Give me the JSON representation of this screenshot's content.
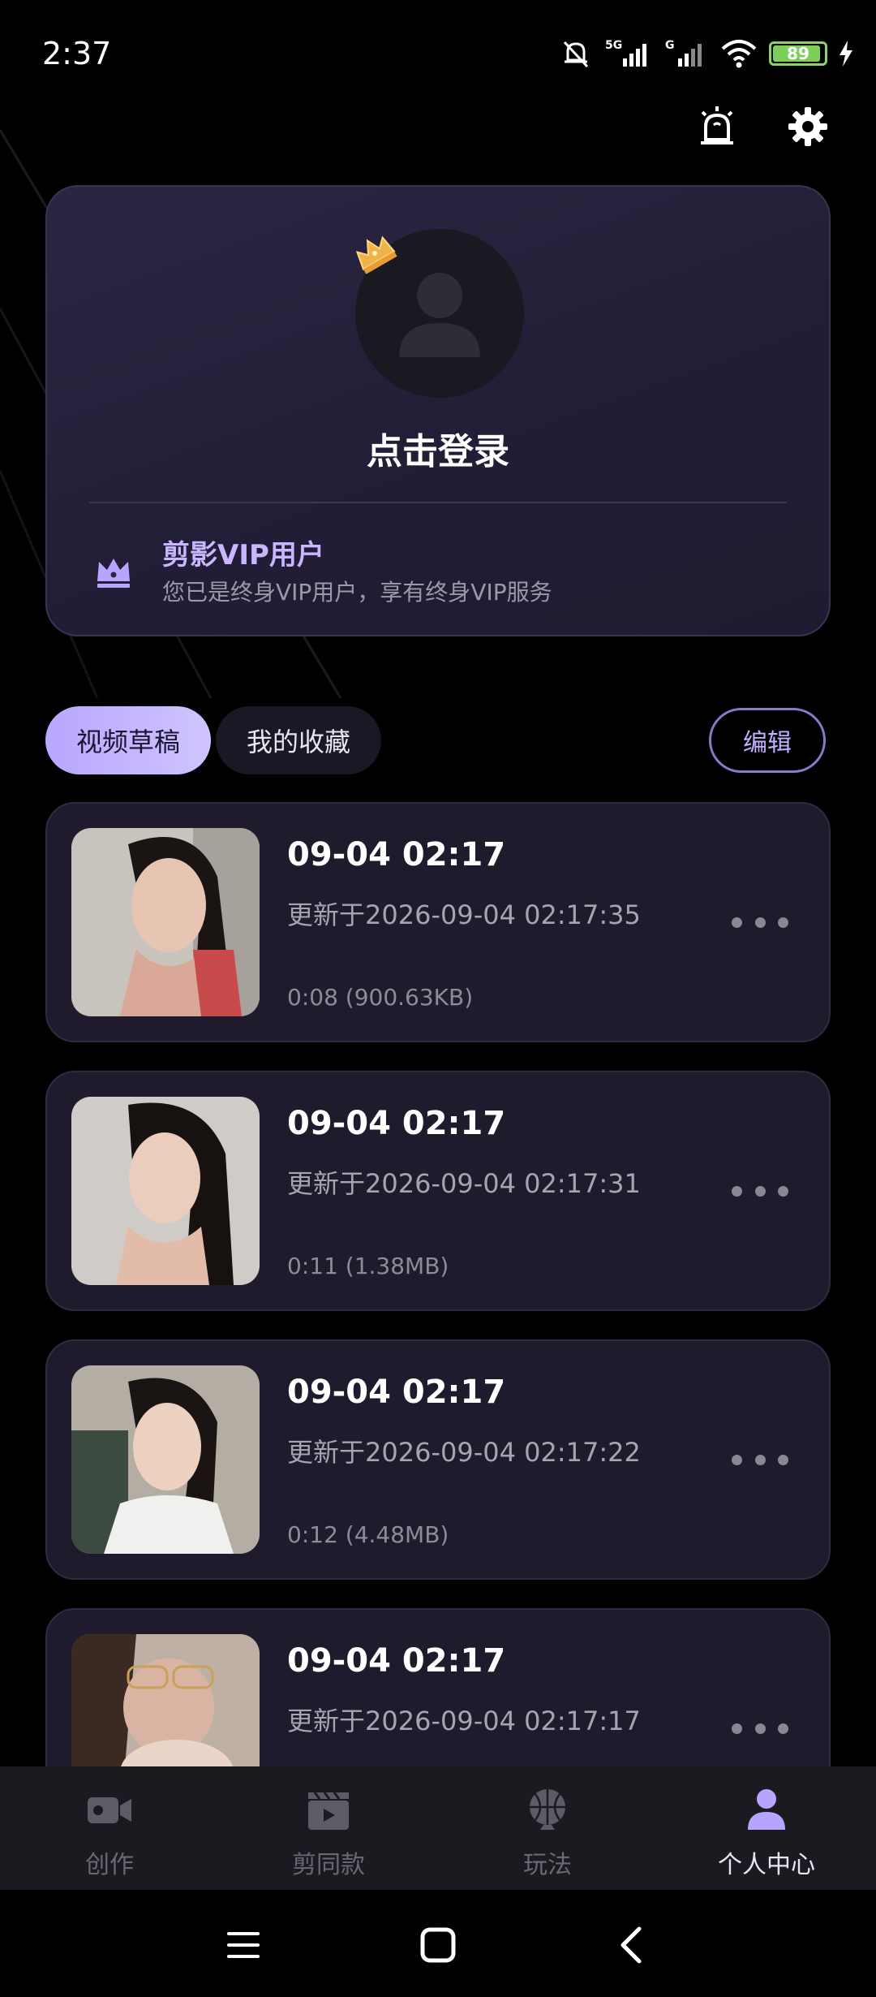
{
  "status_bar": {
    "time": "2:37",
    "battery": "89",
    "network": "5G"
  },
  "profile": {
    "login_label": "点击登录",
    "vip_title": "剪影VIP用户",
    "vip_desc": "您已是终身VIP用户，享有终身VIP服务"
  },
  "tabs": [
    {
      "label": "视频草稿",
      "active": true
    },
    {
      "label": "我的收藏",
      "active": false
    }
  ],
  "edit_label": "编辑",
  "drafts": [
    {
      "title": "09-04 02:17",
      "updated": "更新于2026-09-04 02:17:35",
      "meta": "0:08 (900.63KB)"
    },
    {
      "title": "09-04 02:17",
      "updated": "更新于2026-09-04 02:17:31",
      "meta": "0:11 (1.38MB)"
    },
    {
      "title": "09-04 02:17",
      "updated": "更新于2026-09-04 02:17:22",
      "meta": "0:12 (4.48MB)"
    },
    {
      "title": "09-04 02:17",
      "updated": "更新于2026-09-04 02:17:17",
      "meta": ""
    }
  ],
  "bottom_nav": [
    {
      "label": "创作",
      "icon": "video-camera-icon",
      "active": false
    },
    {
      "label": "剪同款",
      "icon": "clapperboard-icon",
      "active": false
    },
    {
      "label": "玩法",
      "icon": "basketball-icon",
      "active": false
    },
    {
      "label": "个人中心",
      "icon": "person-icon",
      "active": true
    }
  ],
  "colors": {
    "accent": "#b9a6ff",
    "card_bg": "#1f1b2d",
    "vip_text": "#c9b6ff"
  }
}
